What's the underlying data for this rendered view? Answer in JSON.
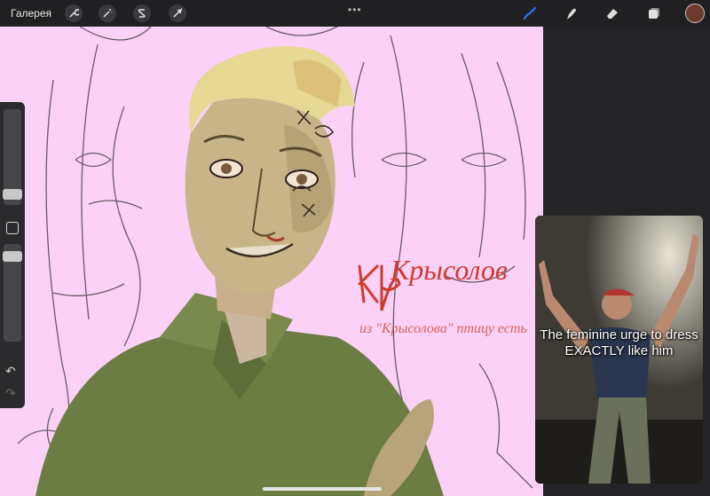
{
  "topbar": {
    "gallery_label": "Галерея",
    "left_tools": [
      "wrench-icon",
      "magic-wand-icon",
      "selection-icon",
      "transform-icon"
    ],
    "more_label": "•••",
    "right_tools": [
      "brush-icon",
      "smudge-icon",
      "eraser-icon",
      "layers-icon"
    ],
    "active_tool": "brush-icon",
    "accent": "#2f6df6",
    "current_color": "#6b3a2d"
  },
  "canvas": {
    "background": "#fbd1f8",
    "title_text": "Крысолов",
    "subtitle_text": "из \"Крысолова\" птицу есть"
  },
  "meme": {
    "caption": "The feminine urge to dress EXACTLY like him"
  }
}
